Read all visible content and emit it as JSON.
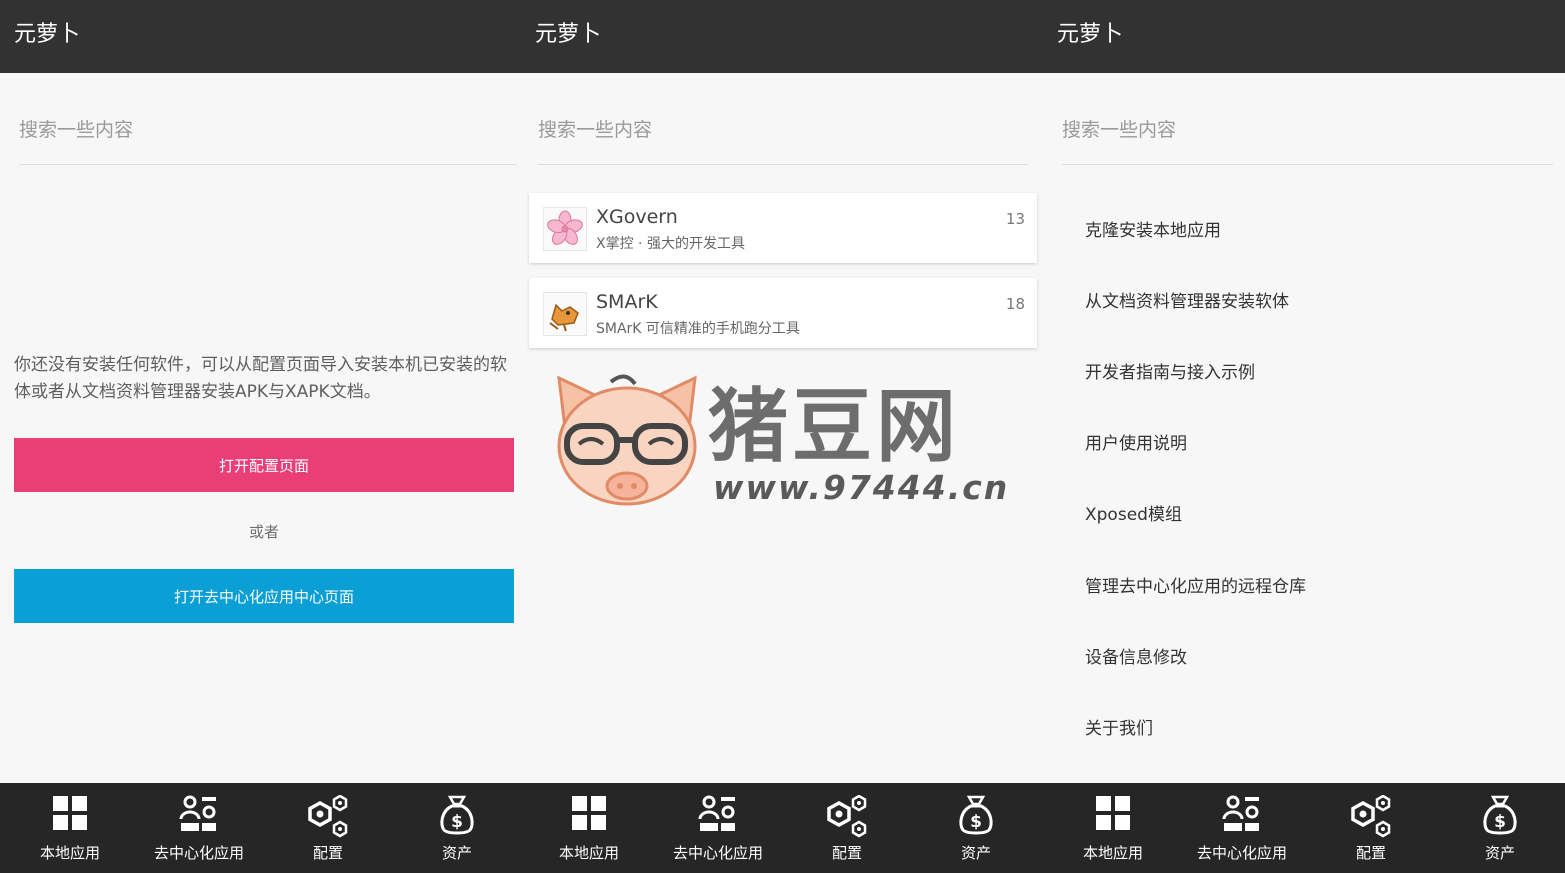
{
  "app_title": "元萝卜",
  "search": {
    "placeholder": "搜索一些内容"
  },
  "local_apps": {
    "empty_message": "你还没有安装任何软件，可以从配置页面导入安装本机已安装的软体或者从文档资料管理器安装APK与XAPK文档。",
    "open_config_label": "打开配置页面",
    "or_label": "或者",
    "open_dapp_label": "打开去中心化应用中心页面"
  },
  "dapps": [
    {
      "name": "XGovern",
      "description": "X掌控 · 强大的开发工具",
      "count": "13",
      "icon": "sakura-icon"
    },
    {
      "name": "SMArK",
      "description": "SMArK 可信精准的手机跑分工具",
      "count": "18",
      "icon": "fox-icon"
    }
  ],
  "config_menu": [
    "克隆安装本地应用",
    "从文档资料管理器安装软体",
    "开发者指南与接入示例",
    "用户使用说明",
    "Xposed模组",
    "管理去中心化应用的远程仓库",
    "设备信息修改",
    "关于我们"
  ],
  "bottom_nav": [
    {
      "label": "本地应用",
      "icon": "grid-icon"
    },
    {
      "label": "去中心化应用",
      "icon": "people-icon"
    },
    {
      "label": "配置",
      "icon": "settings-icon"
    },
    {
      "label": "资产",
      "icon": "money-bag-icon"
    }
  ],
  "watermark": {
    "text": "猪豆网",
    "url": "www.97444.cn"
  },
  "colors": {
    "appbar": "#323232",
    "nav": "#262626",
    "pink_button": "#ea3e77",
    "blue_button": "#0aa0d6",
    "background": "#f7f7f7"
  }
}
